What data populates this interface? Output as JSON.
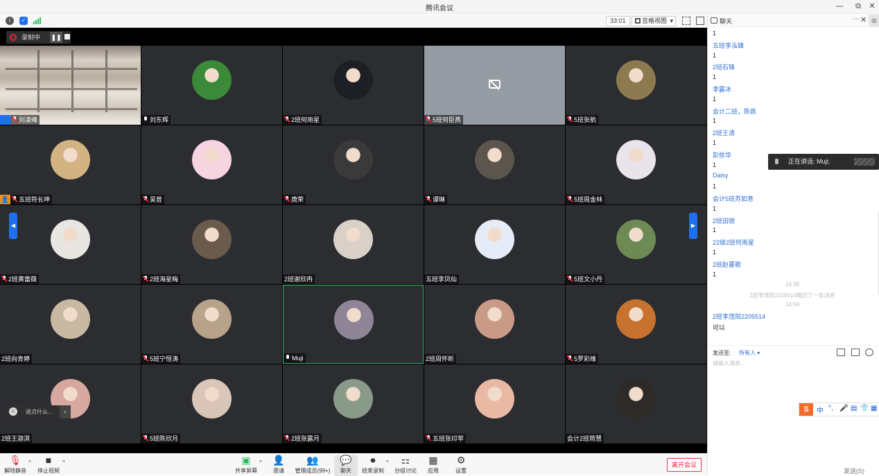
{
  "window": {
    "title": "腾讯会议"
  },
  "topbar": {
    "timer": "33:01",
    "view_label": "宫格视图",
    "icons": [
      "info-icon",
      "shield-icon",
      "signal-icon",
      "fullscreen-icon",
      "sidebar-icon"
    ]
  },
  "recording": {
    "label": "录制中",
    "pause_label": "❚❚"
  },
  "tiles": [
    {
      "name": "刘凌峰",
      "mic": "muted",
      "host": true,
      "host_color": "#1e6ff2",
      "bg": "photo"
    },
    {
      "name": "刘东辉",
      "mic": "on",
      "avatar_color": "#3b8a3a"
    },
    {
      "name": "2班何雨星",
      "mic": "muted",
      "avatar_color": "#1d1f24"
    },
    {
      "name": "5班何臣燕",
      "mic": "muted",
      "nocam": true
    },
    {
      "name": "5班张航",
      "mic": "muted",
      "avatar_color": "#8e7a50"
    },
    {
      "name": "五班符长坤",
      "mic": "muted",
      "host": true,
      "host_color": "#f28a1e",
      "avatar_color": "#d4b382"
    },
    {
      "name": "吴昔",
      "mic": "muted",
      "avatar_color": "#f7d5e0"
    },
    {
      "name": "唐荣",
      "mic": "muted",
      "avatar_color": "#3a3a3a"
    },
    {
      "name": "谭琳",
      "mic": "muted",
      "avatar_color": "#5c554e"
    },
    {
      "name": "5班周金林",
      "mic": "muted",
      "avatar_color": "#e8e4ea"
    },
    {
      "name": "2班黄蕾薇",
      "mic": "muted",
      "avatar_color": "#e9e6e2"
    },
    {
      "name": "2班海星梅",
      "mic": "muted",
      "avatar_color": "#6b5b4c"
    },
    {
      "name": "2班谢欣冉",
      "mic": "",
      "avatar_color": "#d9d0c8"
    },
    {
      "name": "五班李凤仙",
      "mic": "",
      "avatar_color": "#e6ecf7"
    },
    {
      "name": "5班文小丹",
      "mic": "muted",
      "avatar_color": "#6d8a54"
    },
    {
      "name": "2班向青婷",
      "mic": "",
      "avatar_color": "#c9b9a3"
    },
    {
      "name": "5班宁恒涛",
      "mic": "muted",
      "avatar_color": "#b8a38a"
    },
    {
      "name": "Muji",
      "mic": "on",
      "active": true,
      "avatar_color": "#8f8596"
    },
    {
      "name": "2班周怀昕",
      "mic": "",
      "avatar_color": "#c99a86"
    },
    {
      "name": "5罗彩维",
      "mic": "muted",
      "avatar_color": "#c8722f"
    },
    {
      "name": "2班王迦淇",
      "mic": "",
      "avatar_color": "#d8a8a0"
    },
    {
      "name": "5班陈欣月",
      "mic": "muted",
      "avatar_color": "#d9c6b8"
    },
    {
      "name": "2班张露月",
      "mic": "muted",
      "avatar_color": "#8a9a8a"
    },
    {
      "name": "五班张印苹",
      "mic": "muted",
      "avatar_color": "#e9b9a4"
    },
    {
      "name": "会计2班简慧",
      "mic": "",
      "avatar_color": "#2d2a28"
    }
  ],
  "bubble": {
    "placeholder": "说点什么..."
  },
  "speaking": {
    "text": "正在讲话: Muji;"
  },
  "toolbar": {
    "unmute": "解除静音",
    "stop_video": "停止视频",
    "share": "共享屏幕",
    "invite": "邀请",
    "members": "管理成员(99+)",
    "chat": "聊天",
    "end_record": "结束录制",
    "breakout": "分组讨论",
    "apps": "应用",
    "settings": "设置",
    "leave": "离开会议"
  },
  "chat": {
    "title": "聊天",
    "messages": [
      {
        "type": "text",
        "text": "1"
      },
      {
        "type": "sender",
        "text": "五班李泓臻"
      },
      {
        "type": "text",
        "text": "1"
      },
      {
        "type": "sender",
        "text": "2班石锋"
      },
      {
        "type": "text",
        "text": "1"
      },
      {
        "type": "sender",
        "text": "李露冰"
      },
      {
        "type": "text",
        "text": "1"
      },
      {
        "type": "sender",
        "text": "会计二班，陈炼"
      },
      {
        "type": "text",
        "text": "1"
      },
      {
        "type": "sender",
        "text": "2班王清"
      },
      {
        "type": "text",
        "text": "1"
      },
      {
        "type": "sender",
        "text": "彭依华"
      },
      {
        "type": "text",
        "text": "1"
      },
      {
        "type": "sender",
        "text": "Daisy"
      },
      {
        "type": "text",
        "text": "1"
      },
      {
        "type": "sender",
        "text": "会计5班苏如意"
      },
      {
        "type": "text",
        "text": "1"
      },
      {
        "type": "sender",
        "text": "2班田锐"
      },
      {
        "type": "text",
        "text": "1"
      },
      {
        "type": "sender",
        "text": "22级2班何雨星"
      },
      {
        "type": "text",
        "text": "1"
      },
      {
        "type": "sender",
        "text": "2班赵蔓歌"
      },
      {
        "type": "text",
        "text": "1"
      },
      {
        "type": "system",
        "text": "14:39"
      },
      {
        "type": "system",
        "text": "2班李茂阳2205514撤回了一条消息"
      },
      {
        "type": "system",
        "text": "14:59"
      },
      {
        "type": "sender",
        "text": "2班李茂阳2205514"
      },
      {
        "type": "text",
        "text": "可以"
      }
    ],
    "send_to_label": "发送至:",
    "send_to_value": "所有人 ▾",
    "input_placeholder": "请输入消息...",
    "ime_logo": "S",
    "ime_keys": [
      "中",
      "°,",
      "🎤",
      "▤",
      "👕",
      "▦"
    ],
    "send_button": "发送(S)"
  }
}
